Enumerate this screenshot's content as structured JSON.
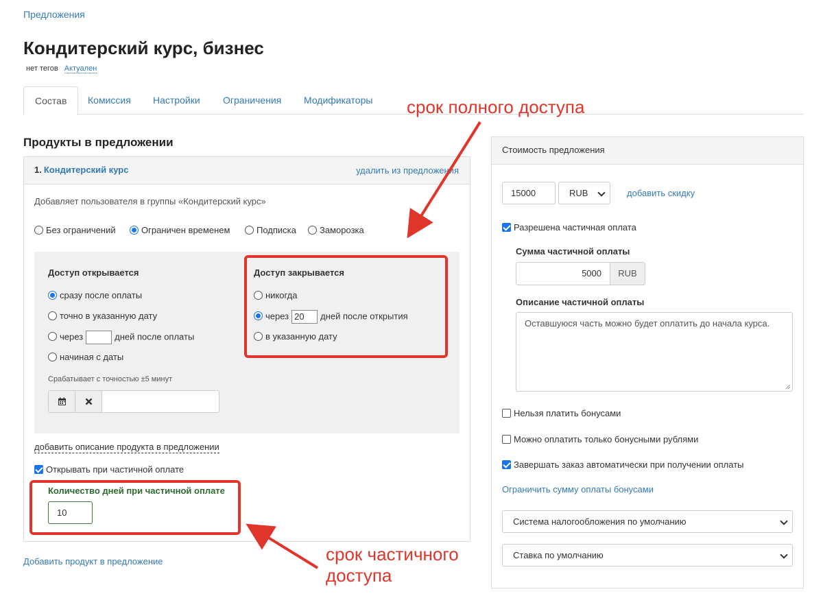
{
  "breadcrumb": "Предложения",
  "title": "Кондитерский курс, бизнес",
  "tags": {
    "none": "нет тегов",
    "status": "Актуален"
  },
  "tabs": [
    "Состав",
    "Комиссия",
    "Настройки",
    "Ограничения",
    "Модификаторы"
  ],
  "products_section_title": "Продукты в предложении",
  "product": {
    "number": "1.",
    "name": "Кондитерский курс",
    "remove_link": "удалить из предложения",
    "description": "Добавляет пользователя в группы «Кондитерский курс»",
    "access_types": [
      "Без ограничений",
      "Ограничен временем",
      "Подписка",
      "Заморозка"
    ],
    "access_type_selected": "Ограничен временем",
    "opens": {
      "title": "Доступ открывается",
      "options": [
        "сразу после оплаты",
        "точно в указанную дату",
        "через",
        "начиная с даты"
      ],
      "days_suffix": "дней после оплаты",
      "selected": "сразу после оплаты",
      "precision_hint": "Срабатывает с точностью ±5 минут"
    },
    "closes": {
      "title": "Доступ закрывается",
      "options": [
        "никогда",
        "через",
        "в указанную дату"
      ],
      "days_value": "20",
      "days_suffix": "дней после открытия",
      "selected": "через"
    },
    "add_description_link": "добавить описание продукта в предложении",
    "open_on_partial_label": "Открывать при частичной оплате",
    "open_on_partial_checked": true,
    "partial_days_label": "Количество дней при частичной оплате",
    "partial_days_value": "10"
  },
  "add_product_link": "Добавить продукт в предложение",
  "annotations": {
    "full_access": "срок полного доступа",
    "partial_access_line1": "срок частичного",
    "partial_access_line2": "доступа"
  },
  "price_panel": {
    "title": "Стоимость предложения",
    "price_value": "15000",
    "currency": "RUB",
    "add_discount_link": "добавить скидку",
    "partial_allowed_label": "Разрешена частичная оплата",
    "partial_allowed_checked": true,
    "partial_sum_label": "Сумма частичной оплаты",
    "partial_sum_value": "5000",
    "partial_sum_currency": "RUB",
    "partial_desc_label": "Описание частичной оплаты",
    "partial_desc_value": "Оставшуюся часть можно будет оплатить до начала курса.",
    "no_bonus_label": "Нельзя платить бонусами",
    "no_bonus_checked": false,
    "only_bonus_label": "Можно оплатить только бонусными рублями",
    "only_bonus_checked": false,
    "auto_complete_label": "Завершать заказ автоматически при получении оплаты",
    "auto_complete_checked": true,
    "limit_bonus_link": "Ограничить сумму оплаты бонусами",
    "tax_system": "Система налогообложения по умолчанию",
    "tax_rate": "Ставка по умолчанию"
  },
  "colors": {
    "link": "#337ab7",
    "annotation": "#e0352b",
    "accent": "#1a73e8"
  },
  "icons": [
    "calendar-icon",
    "close-icon",
    "chevron-down-icon"
  ]
}
